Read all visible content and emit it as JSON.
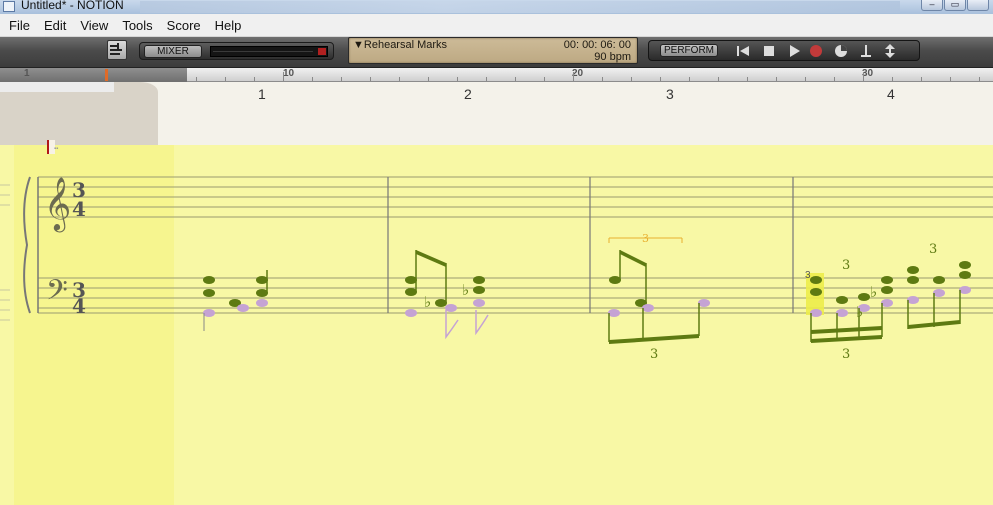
{
  "window": {
    "title": "Untitled* - NOTION",
    "controls": [
      "minimize",
      "maximize",
      "close"
    ]
  },
  "menu": [
    "File",
    "Edit",
    "View",
    "Tools",
    "Score",
    "Help"
  ],
  "toolbar": {
    "mixer_label": "MIXER",
    "rehearsal_marks_label": "Rehearsal Marks",
    "time_display": "00: 00: 06: 00",
    "tempo_display": "90 bpm",
    "perform_label": "PERFORM"
  },
  "transport_icons": [
    "rewind-to-start-icon",
    "stop-icon",
    "play-icon",
    "record-icon",
    "metronome-icon",
    "count-off-icon",
    "loop-icon"
  ],
  "ruler": {
    "labels": [
      "1",
      "10",
      "20",
      "30"
    ]
  },
  "measures": [
    "1",
    "2",
    "3",
    "4"
  ],
  "score": {
    "treble_time_signature": {
      "top": "3",
      "bottom": "4"
    },
    "bass_time_signature": {
      "top": "3",
      "bottom": "4"
    },
    "tuplet_marks": [
      "3",
      "3",
      "3",
      "3",
      "3",
      "3"
    ],
    "accidentals": [
      "flat",
      "flat",
      "flat",
      "flat"
    ]
  },
  "colors": {
    "score_background": "#f8f8a5",
    "note_green": "#5e7a12",
    "note_lavender": "#c5a3d4",
    "selection_yellow": "#ecec4a",
    "accent_orange": "#e06b28"
  }
}
